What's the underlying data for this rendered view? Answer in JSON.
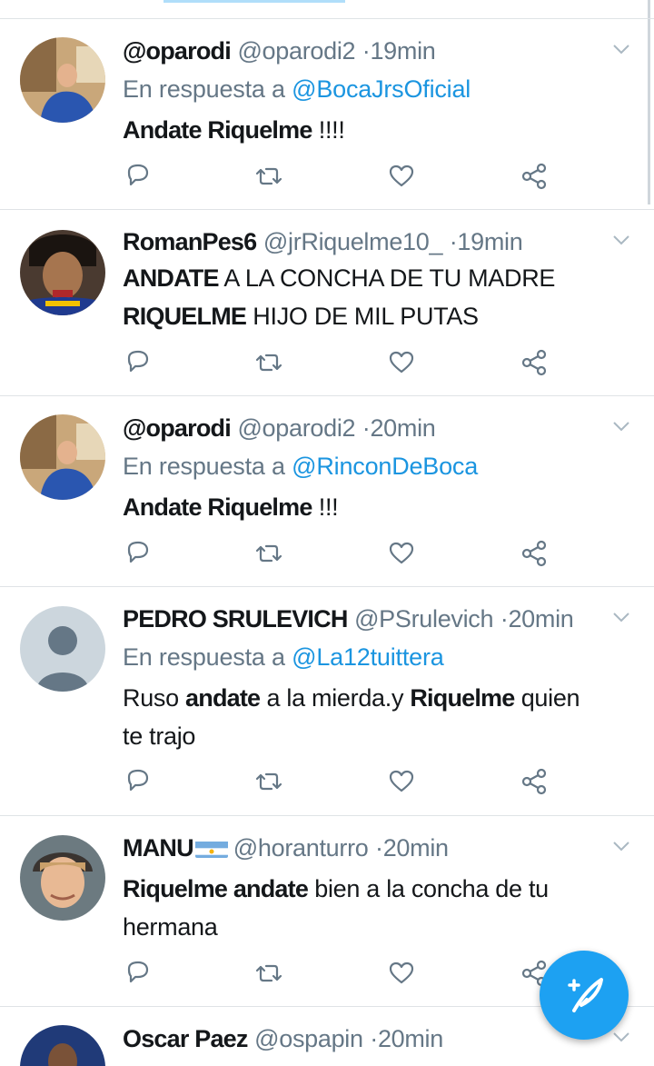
{
  "tweets": [
    {
      "name": "@oparodi",
      "handle": "@oparodi2",
      "time": "19min",
      "reply_prefix": "En respuesta a",
      "reply_to": "@BocaJrsOficial",
      "body_parts": [
        [
          "b",
          "Andate Riquelme"
        ],
        [
          "t",
          " !!!!"
        ]
      ]
    },
    {
      "name": "RomanPes6",
      "handle": "@jrRiquelme10_",
      "time": "19min",
      "reply_prefix": "",
      "reply_to": "",
      "body_parts": [
        [
          "b",
          "ANDATE"
        ],
        [
          "t",
          " A LA CONCHA DE TU MADRE "
        ],
        [
          "b",
          "RIQUELME"
        ],
        [
          "t",
          " HIJO DE MIL PUTAS"
        ]
      ]
    },
    {
      "name": "@oparodi",
      "handle": "@oparodi2",
      "time": "20min",
      "reply_prefix": "En respuesta a",
      "reply_to": "@RinconDeBoca",
      "body_parts": [
        [
          "b",
          "Andate Riquelme"
        ],
        [
          "t",
          " !!!"
        ]
      ]
    },
    {
      "name": "PEDRO SRULEVICH",
      "handle": "@PSrulevich",
      "time": "20min",
      "reply_prefix": "En respuesta a",
      "reply_to": "@La12tuittera",
      "body_parts": [
        [
          "t",
          "Ruso "
        ],
        [
          "b",
          "andate"
        ],
        [
          "t",
          " a la mierda.y "
        ],
        [
          "b",
          "Riquelme"
        ],
        [
          "t",
          " quien te trajo"
        ]
      ]
    },
    {
      "name": "MANU",
      "handle": "@horanturro",
      "time": "20min",
      "reply_prefix": "",
      "reply_to": "",
      "body_parts": [
        [
          "b",
          "Riquelme andate"
        ],
        [
          "t",
          " bien a la concha de tu hermana"
        ]
      ]
    },
    {
      "name": "Oscar Paez",
      "handle": "@ospapin",
      "time": "20min",
      "reply_prefix": "",
      "reply_to": "",
      "body_parts": []
    }
  ],
  "separator": "·",
  "icons": [
    "reply-icon",
    "retweet-icon",
    "like-icon",
    "share-icon",
    "chevron-down-icon",
    "compose-tweet-icon"
  ],
  "colors": {
    "accent": "#1da1f2",
    "mention": "#1b95e0",
    "muted": "#657786",
    "text": "#14171a"
  }
}
